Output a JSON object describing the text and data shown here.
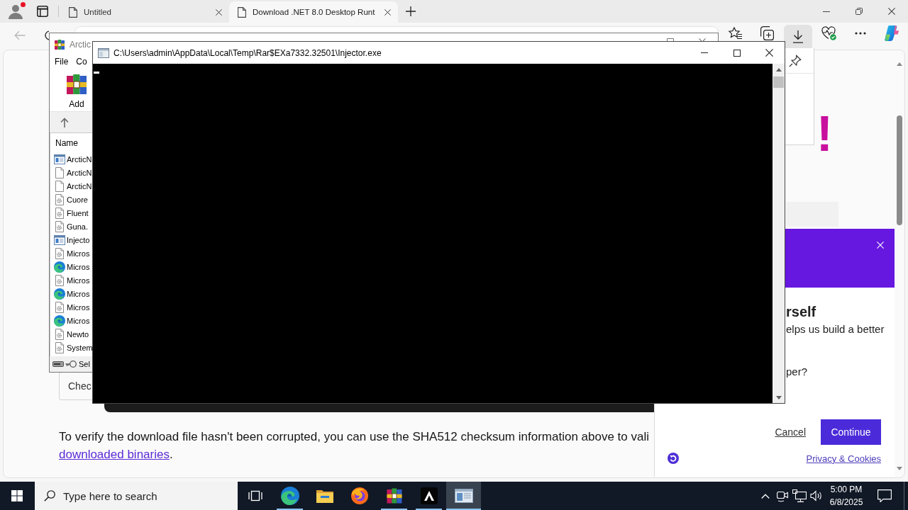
{
  "browser": {
    "profile": {
      "notification": true
    },
    "tabs": [
      {
        "title": "Untitled",
        "selected": false
      },
      {
        "title": "Download .NET 8.0 Desktop Runt",
        "selected": true
      }
    ],
    "back": {
      "disabled": true
    },
    "toolbar_buttons": [
      {
        "kind": "favorites",
        "selected": false
      },
      {
        "kind": "collections",
        "selected": false
      },
      {
        "kind": "downloads",
        "selected": true
      },
      {
        "kind": "health",
        "selected": false
      },
      {
        "kind": "more",
        "selected": false
      },
      {
        "kind": "assistant",
        "selected": false
      }
    ],
    "page": {
      "heading": "!",
      "section_label": "Chec",
      "paragraph": {
        "text": "To verify the download file hasn't been corrupted, you can use the SHA512 checksum information above to vali",
        "link": "downloaded binaries",
        "after": "."
      },
      "survey": {
        "heading": "rself",
        "lines": [
          "elps us build a better",
          "per?"
        ],
        "cancel": "Cancel",
        "continue": "Continue",
        "privacy_link": "Privacy & Cookies"
      }
    }
  },
  "archive_window": {
    "title": "Arctic",
    "menu": [
      "File",
      "Co"
    ],
    "toolbar": [
      "Add"
    ],
    "columns": [
      "Name"
    ],
    "files": [
      {
        "name": "ArcticN",
        "kind": "app"
      },
      {
        "name": "ArcticN",
        "kind": "file"
      },
      {
        "name": "ArcticN",
        "kind": "file"
      },
      {
        "name": "Cuore",
        "kind": "library"
      },
      {
        "name": "Fluent",
        "kind": "library"
      },
      {
        "name": "Guna.",
        "kind": "library"
      },
      {
        "name": "Injecto",
        "kind": "app"
      },
      {
        "name": "Micros",
        "kind": "library"
      },
      {
        "name": "Micros",
        "kind": "web"
      },
      {
        "name": "Micros",
        "kind": "library"
      },
      {
        "name": "Micros",
        "kind": "web"
      },
      {
        "name": "Micros",
        "kind": "library"
      },
      {
        "name": "Micros",
        "kind": "web"
      },
      {
        "name": "Newto",
        "kind": "library"
      },
      {
        "name": "System",
        "kind": "library"
      }
    ],
    "status": "Sel"
  },
  "console": {
    "title": "C:\\Users\\admin\\AppData\\Local\\Temp\\Rar$EXa7332.32501\\Injector.exe"
  },
  "taskbar": {
    "search": {
      "placeholder": "Type here to search"
    },
    "apps": [
      {
        "kind": "task-view",
        "running": false,
        "selected": false
      },
      {
        "kind": "edge",
        "running": true,
        "selected": false
      },
      {
        "kind": "explorer",
        "running": false,
        "selected": false
      },
      {
        "kind": "firefox",
        "running": false,
        "selected": false
      },
      {
        "kind": "archiver",
        "running": true,
        "selected": false
      },
      {
        "kind": "a-app",
        "running": true,
        "selected": false
      },
      {
        "kind": "console",
        "running": true,
        "selected": true
      }
    ],
    "clock": {
      "time": "5:00 PM",
      "date": "6/8/2025"
    }
  }
}
